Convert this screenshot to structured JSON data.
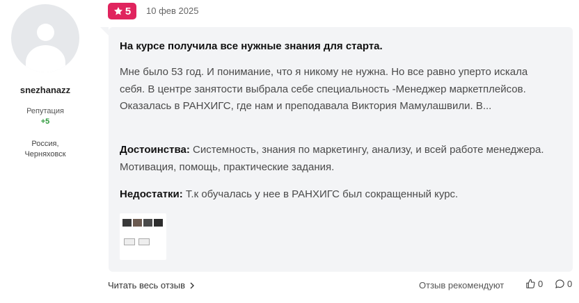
{
  "author": {
    "username": "snezhanazz",
    "reputation_label": "Репутация",
    "reputation_value": "+5",
    "location_line1": "Россия,",
    "location_line2": "Черняховск"
  },
  "review": {
    "rating": "5",
    "date": "10 фев 2025",
    "title": "На курсе получила все нужные знания для старта.",
    "body": "Мне было 53 год. И понимание, что я никому не нужна. Но все равно уперто искала себя. В центре занятости выбрала себе специальность -Менеджер маркетплейсов. Оказалась в РАНХИГС, где нам и преподавала Виктория Мамулашвили. В...",
    "pros_label": "Достоинства:",
    "pros_text": " Системность, знания по маркетингу, анализу, и всей работе менеджера. Мотивация, помощь, практические задания.",
    "cons_label": "Недостатки:",
    "cons_text": " Т.к обучалась у нее в РАНХИГС был сокращенный курс."
  },
  "footer": {
    "read_full": "Читать весь отзыв",
    "recommend_text": "Отзыв рекомендуют",
    "likes_count": "0",
    "comments_count": "0"
  },
  "colors": {
    "rating_badge": "#e0245e",
    "reputation_positive": "#2e9a3c",
    "card_background": "#f3f4f6"
  },
  "icons": {
    "rating": "star-icon",
    "read_more": "chevron-right-icon",
    "likes": "thumbs-up-icon",
    "comments": "comment-icon"
  }
}
